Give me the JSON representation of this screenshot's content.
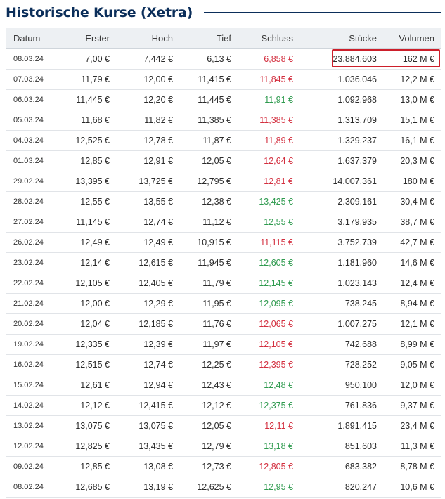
{
  "page": {
    "title": "Historische Kurse (Xetra)"
  },
  "table": {
    "columns": [
      "Datum",
      "Erster",
      "Hoch",
      "Tief",
      "Schluss",
      "Stücke",
      "Volumen"
    ],
    "rows": [
      {
        "datum": "08.03.24",
        "erster": "7,00 €",
        "hoch": "7,442 €",
        "tief": "6,13 €",
        "schluss": "6,858 €",
        "trend": "neg",
        "stuecke": "23.884.603",
        "volumen": "162 M €"
      },
      {
        "datum": "07.03.24",
        "erster": "11,79 €",
        "hoch": "12,00 €",
        "tief": "11,415 €",
        "schluss": "11,845 €",
        "trend": "neg",
        "stuecke": "1.036.046",
        "volumen": "12,2 M €"
      },
      {
        "datum": "06.03.24",
        "erster": "11,445 €",
        "hoch": "12,20 €",
        "tief": "11,445 €",
        "schluss": "11,91 €",
        "trend": "pos",
        "stuecke": "1.092.968",
        "volumen": "13,0 M €"
      },
      {
        "datum": "05.03.24",
        "erster": "11,68 €",
        "hoch": "11,82 €",
        "tief": "11,385 €",
        "schluss": "11,385 €",
        "trend": "neg",
        "stuecke": "1.313.709",
        "volumen": "15,1 M €"
      },
      {
        "datum": "04.03.24",
        "erster": "12,525 €",
        "hoch": "12,78 €",
        "tief": "11,87 €",
        "schluss": "11,89 €",
        "trend": "neg",
        "stuecke": "1.329.237",
        "volumen": "16,1 M €"
      },
      {
        "datum": "01.03.24",
        "erster": "12,85 €",
        "hoch": "12,91 €",
        "tief": "12,05 €",
        "schluss": "12,64 €",
        "trend": "neg",
        "stuecke": "1.637.379",
        "volumen": "20,3 M €"
      },
      {
        "datum": "29.02.24",
        "erster": "13,395 €",
        "hoch": "13,725 €",
        "tief": "12,795 €",
        "schluss": "12,81 €",
        "trend": "neg",
        "stuecke": "14.007.361",
        "volumen": "180 M €"
      },
      {
        "datum": "28.02.24",
        "erster": "12,55 €",
        "hoch": "13,55 €",
        "tief": "12,38 €",
        "schluss": "13,425 €",
        "trend": "pos",
        "stuecke": "2.309.161",
        "volumen": "30,4 M €"
      },
      {
        "datum": "27.02.24",
        "erster": "11,145 €",
        "hoch": "12,74 €",
        "tief": "11,12 €",
        "schluss": "12,55 €",
        "trend": "pos",
        "stuecke": "3.179.935",
        "volumen": "38,7 M €"
      },
      {
        "datum": "26.02.24",
        "erster": "12,49 €",
        "hoch": "12,49 €",
        "tief": "10,915 €",
        "schluss": "11,115 €",
        "trend": "neg",
        "stuecke": "3.752.739",
        "volumen": "42,7 M €"
      },
      {
        "datum": "23.02.24",
        "erster": "12,14 €",
        "hoch": "12,615 €",
        "tief": "11,945 €",
        "schluss": "12,605 €",
        "trend": "pos",
        "stuecke": "1.181.960",
        "volumen": "14,6 M €"
      },
      {
        "datum": "22.02.24",
        "erster": "12,105 €",
        "hoch": "12,405 €",
        "tief": "11,79 €",
        "schluss": "12,145 €",
        "trend": "pos",
        "stuecke": "1.023.143",
        "volumen": "12,4 M €"
      },
      {
        "datum": "21.02.24",
        "erster": "12,00 €",
        "hoch": "12,29 €",
        "tief": "11,95 €",
        "schluss": "12,095 €",
        "trend": "pos",
        "stuecke": "738.245",
        "volumen": "8,94 M €"
      },
      {
        "datum": "20.02.24",
        "erster": "12,04 €",
        "hoch": "12,185 €",
        "tief": "11,76 €",
        "schluss": "12,065 €",
        "trend": "neg",
        "stuecke": "1.007.275",
        "volumen": "12,1 M €"
      },
      {
        "datum": "19.02.24",
        "erster": "12,335 €",
        "hoch": "12,39 €",
        "tief": "11,97 €",
        "schluss": "12,105 €",
        "trend": "neg",
        "stuecke": "742.688",
        "volumen": "8,99 M €"
      },
      {
        "datum": "16.02.24",
        "erster": "12,515 €",
        "hoch": "12,74 €",
        "tief": "12,25 €",
        "schluss": "12,395 €",
        "trend": "neg",
        "stuecke": "728.252",
        "volumen": "9,05 M €"
      },
      {
        "datum": "15.02.24",
        "erster": "12,61 €",
        "hoch": "12,94 €",
        "tief": "12,43 €",
        "schluss": "12,48 €",
        "trend": "pos",
        "stuecke": "950.100",
        "volumen": "12,0 M €"
      },
      {
        "datum": "14.02.24",
        "erster": "12,12 €",
        "hoch": "12,415 €",
        "tief": "12,12 €",
        "schluss": "12,375 €",
        "trend": "pos",
        "stuecke": "761.836",
        "volumen": "9,37 M €"
      },
      {
        "datum": "13.02.24",
        "erster": "13,075 €",
        "hoch": "13,075 €",
        "tief": "12,05 €",
        "schluss": "12,11 €",
        "trend": "neg",
        "stuecke": "1.891.415",
        "volumen": "23,4 M €"
      },
      {
        "datum": "12.02.24",
        "erster": "12,825 €",
        "hoch": "13,435 €",
        "tief": "12,79 €",
        "schluss": "13,18 €",
        "trend": "pos",
        "stuecke": "851.603",
        "volumen": "11,3 M €"
      },
      {
        "datum": "09.02.24",
        "erster": "12,85 €",
        "hoch": "13,08 €",
        "tief": "12,73 €",
        "schluss": "12,805 €",
        "trend": "neg",
        "stuecke": "683.382",
        "volumen": "8,78 M €"
      },
      {
        "datum": "08.02.24",
        "erster": "12,685 €",
        "hoch": "13,19 €",
        "tief": "12,625 €",
        "schluss": "12,95 €",
        "trend": "pos",
        "stuecke": "820.247",
        "volumen": "10,6 M €"
      }
    ]
  },
  "colors": {
    "title": "#0b2e5a",
    "header_bg": "#edf0f3",
    "negative": "#d32f3f",
    "positive": "#2e9a4e",
    "highlight_border": "#cc1f2b"
  }
}
